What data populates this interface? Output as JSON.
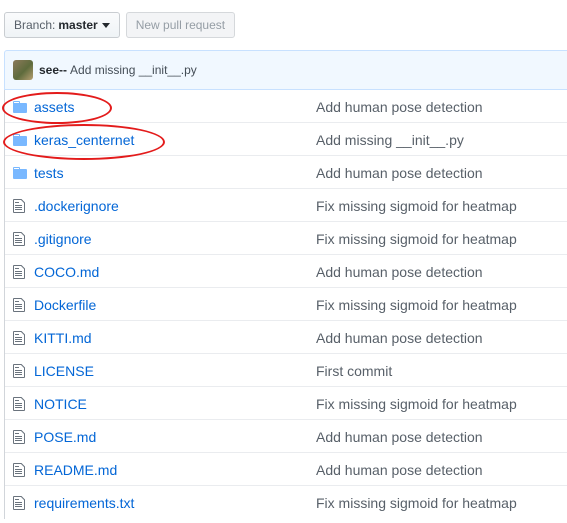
{
  "toolbar": {
    "branch_label": "Branch:",
    "branch_value": "master",
    "new_pull_request": "New pull request"
  },
  "commit": {
    "author": "see--",
    "message": "Add missing __init__.py"
  },
  "files": [
    {
      "type": "dir",
      "name": "assets",
      "message": "Add human pose detection"
    },
    {
      "type": "dir",
      "name": "keras_centernet",
      "message": "Add missing __init__.py"
    },
    {
      "type": "dir",
      "name": "tests",
      "message": "Add human pose detection"
    },
    {
      "type": "file",
      "name": ".dockerignore",
      "message": "Fix missing sigmoid for heatmap"
    },
    {
      "type": "file",
      "name": ".gitignore",
      "message": "Fix missing sigmoid for heatmap"
    },
    {
      "type": "file",
      "name": "COCO.md",
      "message": "Add human pose detection"
    },
    {
      "type": "file",
      "name": "Dockerfile",
      "message": "Fix missing sigmoid for heatmap"
    },
    {
      "type": "file",
      "name": "KITTI.md",
      "message": "Add human pose detection"
    },
    {
      "type": "file",
      "name": "LICENSE",
      "message": "First commit"
    },
    {
      "type": "file",
      "name": "NOTICE",
      "message": "Fix missing sigmoid for heatmap"
    },
    {
      "type": "file",
      "name": "POSE.md",
      "message": "Add human pose detection"
    },
    {
      "type": "file",
      "name": "README.md",
      "message": "Add human pose detection"
    },
    {
      "type": "file",
      "name": "requirements.txt",
      "message": "Fix missing sigmoid for heatmap"
    }
  ],
  "icons": {
    "dir": "folder-icon",
    "file": "file-icon"
  },
  "colors": {
    "link": "#0366d6",
    "folder": "#79b8ff",
    "annotation": "#e31b1b",
    "commit_bg": "#f1f8ff"
  }
}
